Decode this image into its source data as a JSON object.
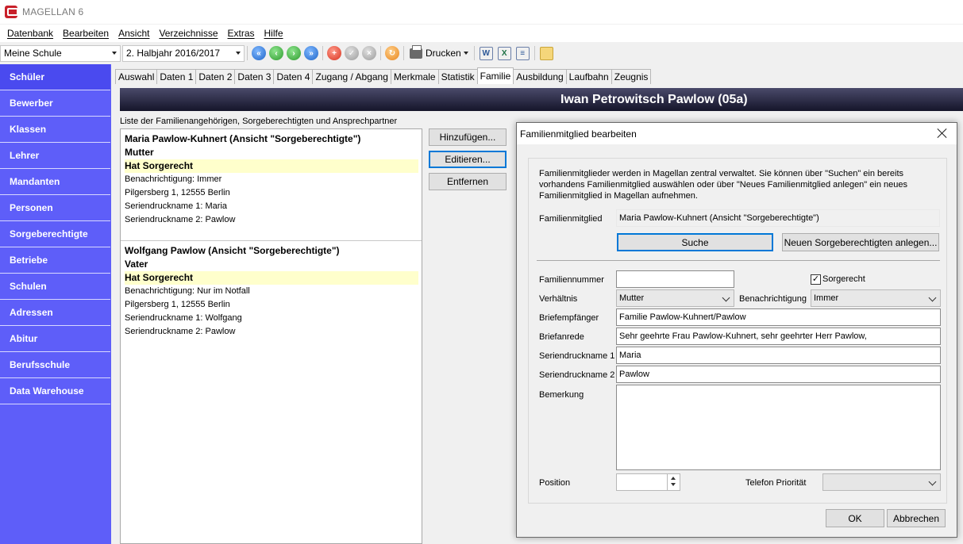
{
  "window": {
    "title": "MAGELLAN 6"
  },
  "menu": [
    "Datenbank",
    "Bearbeiten",
    "Ansicht",
    "Verzeichnisse",
    "Extras",
    "Hilfe"
  ],
  "toolbar": {
    "school": "Meine Schule",
    "term": "2. Halbjahr 2016/2017",
    "print_label": "Drucken"
  },
  "sidebar": [
    "Schüler",
    "Bewerber",
    "Klassen",
    "Lehrer",
    "Mandanten",
    "Personen",
    "Sorgeberechtigte",
    "Betriebe",
    "Schulen",
    "Adressen",
    "Abitur",
    "Berufsschule",
    "Data Warehouse"
  ],
  "tabs": [
    "Auswahl",
    "Daten 1",
    "Daten 2",
    "Daten 3",
    "Daten 4",
    "Zugang / Abgang",
    "Merkmale",
    "Statistik",
    "Familie",
    "Ausbildung",
    "Laufbahn",
    "Zeugnis"
  ],
  "student": {
    "header": "Iwan Petrowitsch Pawlow (05a)"
  },
  "family_list": {
    "label": "Liste der Familienangehörigen, Sorgeberechtigten und Ansprechpartner",
    "members": [
      {
        "name": "Maria Pawlow-Kuhnert (Ansicht \"Sorgeberechtigte\")",
        "relation": "Mutter",
        "custody": "Hat Sorgerecht",
        "notification": "Benachrichtigung: Immer",
        "address": "Pilgersberg 1, 12555 Berlin",
        "mail1": "Seriendruckname 1: Maria",
        "mail2": "Seriendruckname 2: Pawlow"
      },
      {
        "name": "Wolfgang Pawlow (Ansicht \"Sorgeberechtigte\")",
        "relation": "Vater",
        "custody": "Hat Sorgerecht",
        "notification": "Benachrichtigung: Nur im Notfall",
        "address": "Pilgersberg 1, 12555 Berlin",
        "mail1": "Seriendruckname 1: Wolfgang",
        "mail2": "Seriendruckname 2: Pawlow"
      }
    ]
  },
  "list_buttons": {
    "add": "Hinzufügen...",
    "edit": "Editieren...",
    "remove": "Entfernen"
  },
  "dialog": {
    "title": "Familienmitglied bearbeiten",
    "info": "Familienmitglieder werden in Magellan zentral verwaltet. Sie können über \"Suchen\" ein bereits vorhandens Familienmitglied auswählen oder über \"Neues Familienmitglied anlegen\" ein neues Familienmitglied in Magellan aufnehmen.",
    "member_label": "Familienmitglied",
    "member_value": "Maria Pawlow-Kuhnert (Ansicht \"Sorgeberechtigte\")",
    "search_button": "Suche",
    "new_button": "Neuen Sorgeberechtigten anlegen...",
    "family_number_label": "Familiennummer",
    "family_number_value": "",
    "custody_label": "Sorgerecht",
    "custody_checked": "✓",
    "relation_label": "Verhältnis",
    "relation_value": "Mutter",
    "notification_label": "Benachrichtigung",
    "notification_value": "Immer",
    "recipient_label": "Briefempfänger",
    "recipient_value": "Familie Pawlow-Kuhnert/Pawlow",
    "salutation_label": "Briefanrede",
    "salutation_value": "Sehr geehrte Frau Pawlow-Kuhnert, sehr geehrter Herr Pawlow,",
    "mail1_label": "Seriendruckname 1",
    "mail1_value": "Maria",
    "mail2_label": "Seriendruckname 2",
    "mail2_value": "Pawlow",
    "remark_label": "Bemerkung",
    "remark_value": "",
    "position_label": "Position",
    "position_value": "",
    "phone_priority_label": "Telefon Priorität",
    "phone_priority_value": "",
    "ok": "OK",
    "cancel": "Abbrechen"
  }
}
